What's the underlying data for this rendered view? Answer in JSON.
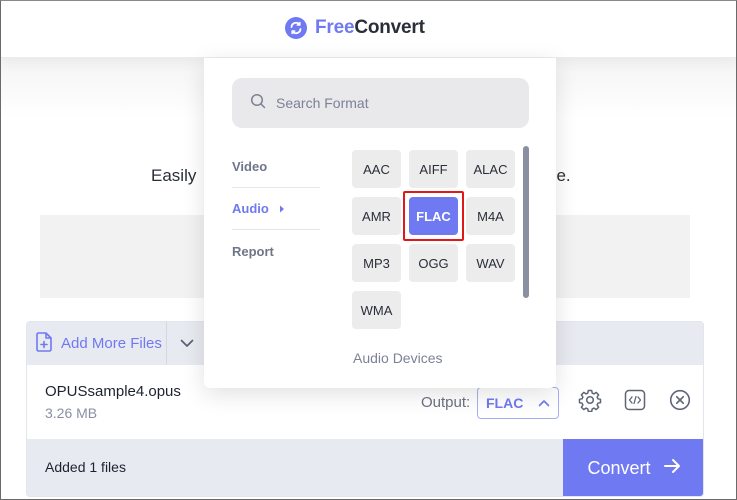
{
  "header": {
    "brand_part1": "Free",
    "brand_part2": "Convert"
  },
  "page": {
    "tagline_left": "Easily",
    "tagline_right": "ne."
  },
  "files_panel": {
    "add_more_label": "Add More Files",
    "file": {
      "name": "OPUSsample4.opus",
      "size": "3.26 MB",
      "output_label": "Output:",
      "output_value": "FLAC"
    },
    "status_text": "Added 1 files",
    "convert_label": "Convert"
  },
  "format_picker": {
    "search_placeholder": "Search Format",
    "categories": [
      {
        "label": "Video",
        "active": false
      },
      {
        "label": "Audio",
        "active": true
      },
      {
        "label": "Report",
        "active": false
      }
    ],
    "formats": [
      "AAC",
      "AIFF",
      "ALAC",
      "AMR",
      "FLAC",
      "M4A",
      "MP3",
      "OGG",
      "WAV",
      "WMA"
    ],
    "selected_format": "FLAC",
    "section_heading": "Audio Devices"
  },
  "colors": {
    "accent": "#6f79f2",
    "highlight": "#e0181a",
    "toolbar_bg": "#e8eaf1"
  }
}
